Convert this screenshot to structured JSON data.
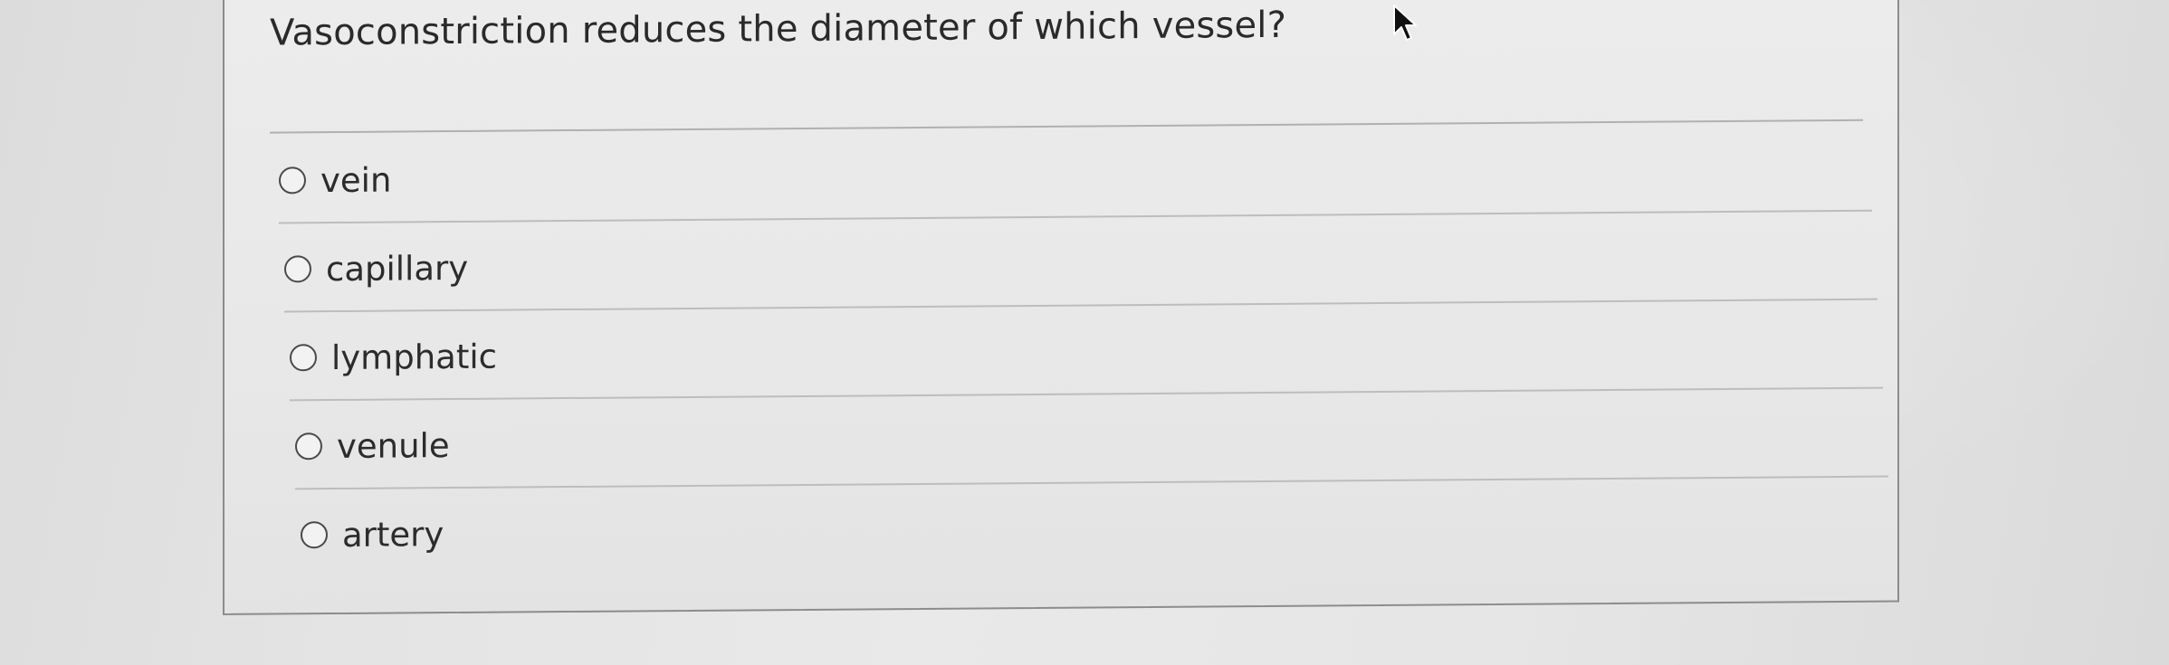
{
  "question": {
    "text": "Vasoconstriction reduces the diameter of which vessel?"
  },
  "options": [
    {
      "label": "vein",
      "selected": false
    },
    {
      "label": "capillary",
      "selected": false
    },
    {
      "label": "lymphatic",
      "selected": false
    },
    {
      "label": "venule",
      "selected": false
    },
    {
      "label": "artery",
      "selected": false
    }
  ],
  "colors": {
    "text": "#2a2a2a",
    "border": "#8c8c8c",
    "divider": "#bdbdbd"
  },
  "icons": {
    "cursor": "mouse-pointer-icon",
    "radio": "radio-unchecked-icon"
  }
}
